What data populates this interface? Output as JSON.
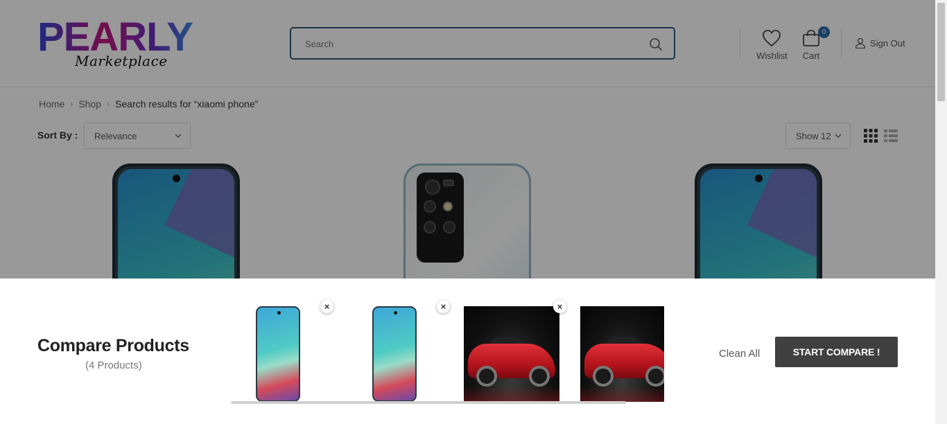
{
  "header": {
    "logo_main": "PEARLY",
    "logo_sub": "Marketplace",
    "search_placeholder": "Search",
    "wishlist_label": "Wishlist",
    "cart_label": "Cart",
    "cart_count": "0",
    "signout_label": "Sign Out"
  },
  "breadcrumb": {
    "home": "Home",
    "shop": "Shop",
    "current": "Search results for “xiaomi phone”"
  },
  "toolbar": {
    "sort_label": "Sort By :",
    "sort_value": "Relevance",
    "show_value": "Show 12",
    "view_modes": [
      "grid-icon",
      "list-icon"
    ],
    "active_view": "grid"
  },
  "products": [
    {
      "image": "phone-front"
    },
    {
      "image": "phone-back"
    },
    {
      "image": "phone-front"
    }
  ],
  "compare": {
    "title": "Compare Products",
    "count": "(4 Products)",
    "items": [
      {
        "image": "phone-front",
        "remove": "×"
      },
      {
        "image": "phone-front",
        "remove": "×"
      },
      {
        "image": "red-sports-car",
        "remove": "×"
      },
      {
        "image": "red-sports-car"
      }
    ],
    "clean_all": "Clean All",
    "start_label": "START COMPARE !"
  },
  "colors": {
    "search_border": "#2b5a78",
    "cart_badge": "#2b6aa8",
    "start_button": "#404040",
    "overlay": "rgba(0,0,0,0.4)"
  }
}
